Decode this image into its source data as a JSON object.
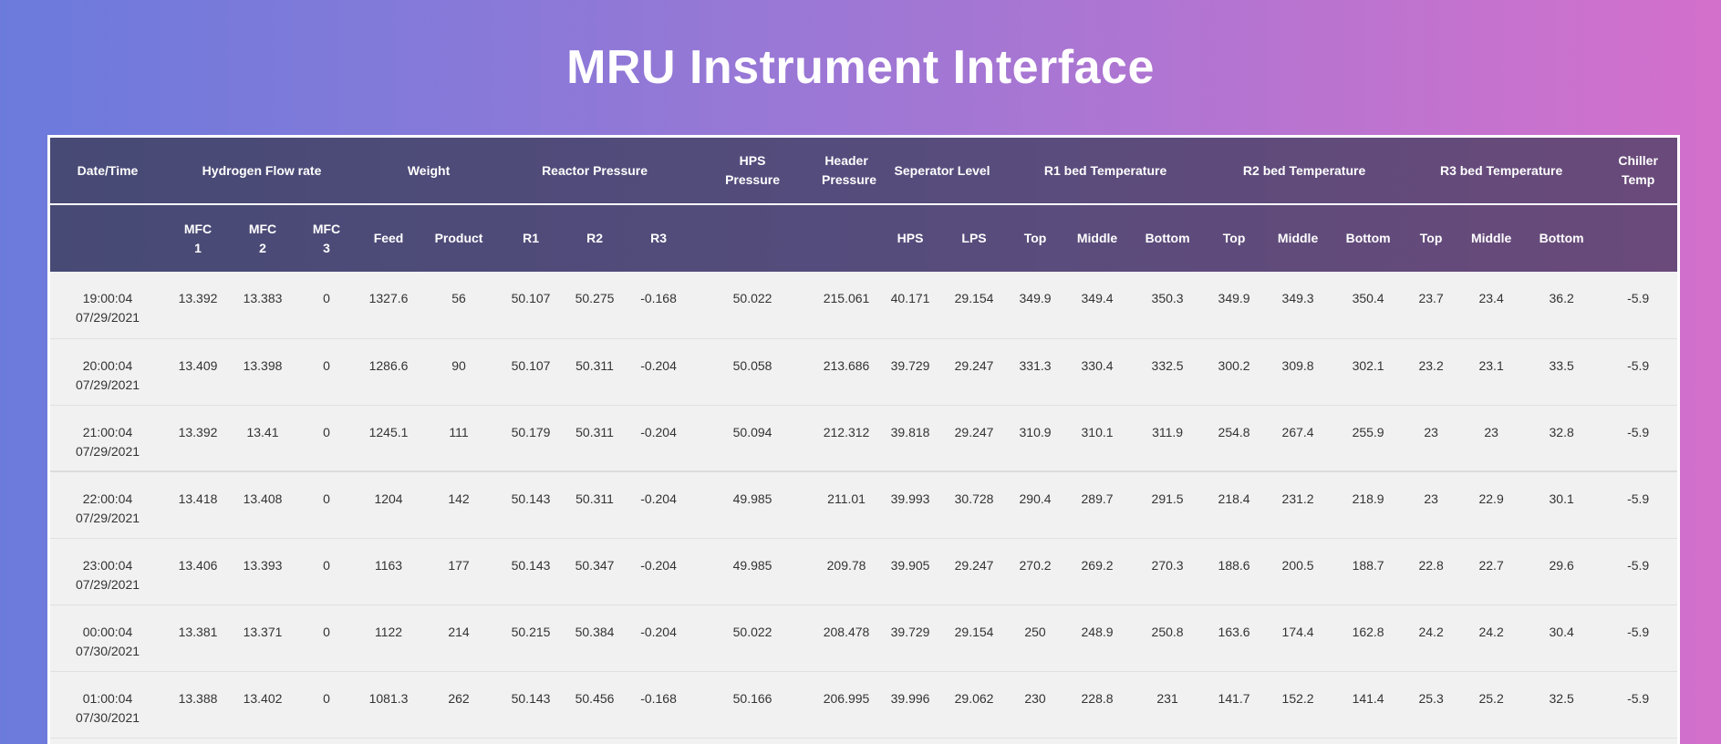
{
  "title": "MRU Instrument Interface",
  "headers": {
    "date_time": "Date/Time",
    "hydrogen": "Hydrogen Flow rate",
    "weight": "Weight",
    "reactor": "Reactor Pressure",
    "hps_pressure": "HPS Pressure",
    "header_pressure": "Header Pressure",
    "separator": "Seperator Level",
    "r1_bed": "R1 bed Temperature",
    "r2_bed": "R2 bed Temperature",
    "r3_bed": "R3 bed Temperature",
    "chiller": "Chiller Temp"
  },
  "subheaders": {
    "mfc1": "MFC 1",
    "mfc2": "MFC 2",
    "mfc3": "MFC 3",
    "feed": "Feed",
    "product": "Product",
    "r1": "R1",
    "r2": "R2",
    "r3": "R3",
    "hps": "HPS",
    "lps": "LPS",
    "r1_top": "Top",
    "r1_middle": "Middle",
    "r1_bottom": "Bottom",
    "r2_top": "Top",
    "r2_middle": "Middle",
    "r2_bottom": "Bottom",
    "r3_top": "Top",
    "r3_middle": "Middle",
    "r3_bottom": "Bottom"
  },
  "rows": [
    {
      "time": "19:00:04",
      "date": "07/29/2021",
      "mfc1": "13.392",
      "mfc2": "13.383",
      "mfc3": "0",
      "feed": "1327.6",
      "product": "56",
      "r1": "50.107",
      "r2": "50.275",
      "r3": "-0.168",
      "hps_p": "50.022",
      "header_p": "215.061",
      "hps": "40.171",
      "lps": "29.154",
      "r1t": "349.9",
      "r1m": "349.4",
      "r1b": "350.3",
      "r2t": "349.9",
      "r2m": "349.3",
      "r2b": "350.4",
      "r3t": "23.7",
      "r3m": "23.4",
      "r3b": "36.2",
      "chiller": "-5.9"
    },
    {
      "time": "20:00:04",
      "date": "07/29/2021",
      "mfc1": "13.409",
      "mfc2": "13.398",
      "mfc3": "0",
      "feed": "1286.6",
      "product": "90",
      "r1": "50.107",
      "r2": "50.311",
      "r3": "-0.204",
      "hps_p": "50.058",
      "header_p": "213.686",
      "hps": "39.729",
      "lps": "29.247",
      "r1t": "331.3",
      "r1m": "330.4",
      "r1b": "332.5",
      "r2t": "300.2",
      "r2m": "309.8",
      "r2b": "302.1",
      "r3t": "23.2",
      "r3m": "23.1",
      "r3b": "33.5",
      "chiller": "-5.9"
    },
    {
      "time": "21:00:04",
      "date": "07/29/2021",
      "mfc1": "13.392",
      "mfc2": "13.41",
      "mfc3": "0",
      "feed": "1245.1",
      "product": "111",
      "r1": "50.179",
      "r2": "50.311",
      "r3": "-0.204",
      "hps_p": "50.094",
      "header_p": "212.312",
      "hps": "39.818",
      "lps": "29.247",
      "r1t": "310.9",
      "r1m": "310.1",
      "r1b": "311.9",
      "r2t": "254.8",
      "r2m": "267.4",
      "r2b": "255.9",
      "r3t": "23",
      "r3m": "23",
      "r3b": "32.8",
      "chiller": "-5.9"
    },
    {
      "time": "22:00:04",
      "date": "07/29/2021",
      "mfc1": "13.418",
      "mfc2": "13.408",
      "mfc3": "0",
      "feed": "1204",
      "product": "142",
      "r1": "50.143",
      "r2": "50.311",
      "r3": "-0.204",
      "hps_p": "49.985",
      "header_p": "211.01",
      "hps": "39.993",
      "lps": "30.728",
      "r1t": "290.4",
      "r1m": "289.7",
      "r1b": "291.5",
      "r2t": "218.4",
      "r2m": "231.2",
      "r2b": "218.9",
      "r3t": "23",
      "r3m": "22.9",
      "r3b": "30.1",
      "chiller": "-5.9"
    },
    {
      "time": "23:00:04",
      "date": "07/29/2021",
      "mfc1": "13.406",
      "mfc2": "13.393",
      "mfc3": "0",
      "feed": "1163",
      "product": "177",
      "r1": "50.143",
      "r2": "50.347",
      "r3": "-0.204",
      "hps_p": "49.985",
      "header_p": "209.78",
      "hps": "39.905",
      "lps": "29.247",
      "r1t": "270.2",
      "r1m": "269.2",
      "r1b": "270.3",
      "r2t": "188.6",
      "r2m": "200.5",
      "r2b": "188.7",
      "r3t": "22.8",
      "r3m": "22.7",
      "r3b": "29.6",
      "chiller": "-5.9"
    },
    {
      "time": "00:00:04",
      "date": "07/30/2021",
      "mfc1": "13.381",
      "mfc2": "13.371",
      "mfc3": "0",
      "feed": "1122",
      "product": "214",
      "r1": "50.215",
      "r2": "50.384",
      "r3": "-0.204",
      "hps_p": "50.022",
      "header_p": "208.478",
      "hps": "39.729",
      "lps": "29.154",
      "r1t": "250",
      "r1m": "248.9",
      "r1b": "250.8",
      "r2t": "163.6",
      "r2m": "174.4",
      "r2b": "162.8",
      "r3t": "24.2",
      "r3m": "24.2",
      "r3b": "30.4",
      "chiller": "-5.9"
    },
    {
      "time": "01:00:04",
      "date": "07/30/2021",
      "mfc1": "13.388",
      "mfc2": "13.402",
      "mfc3": "0",
      "feed": "1081.3",
      "product": "262",
      "r1": "50.143",
      "r2": "50.456",
      "r3": "-0.168",
      "hps_p": "50.166",
      "header_p": "206.995",
      "hps": "39.996",
      "lps": "29.062",
      "r1t": "230",
      "r1m": "228.8",
      "r1b": "231",
      "r2t": "141.7",
      "r2m": "152.2",
      "r2b": "141.4",
      "r3t": "25.3",
      "r3m": "25.2",
      "r3b": "32.5",
      "chiller": "-5.9"
    }
  ]
}
